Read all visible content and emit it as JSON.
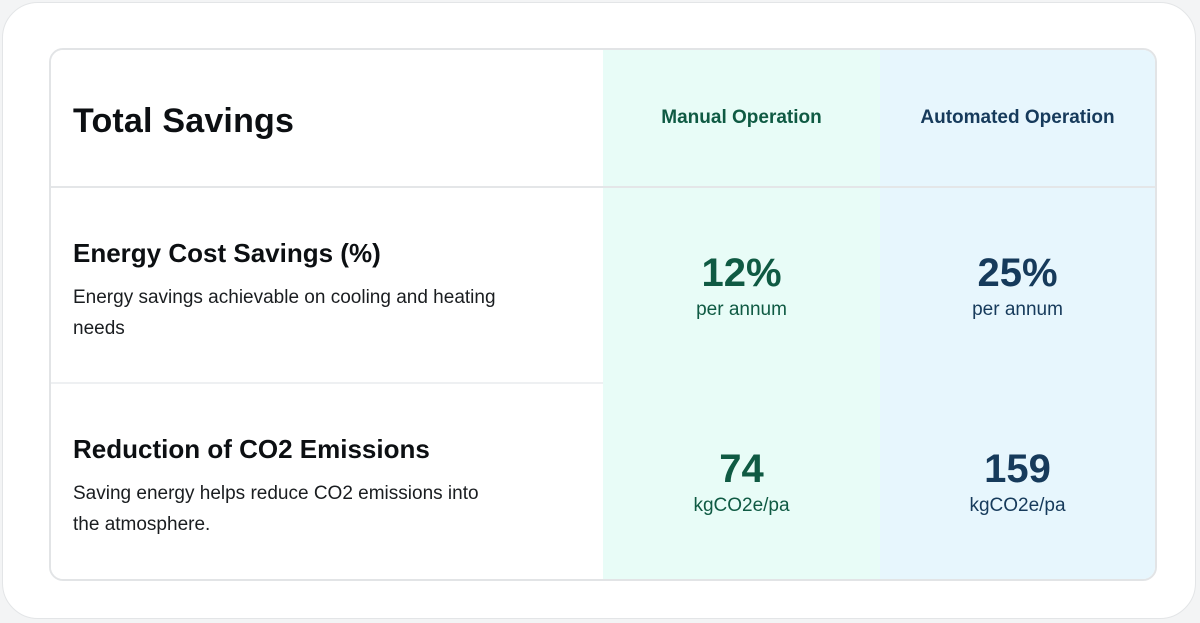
{
  "title": "Total Savings",
  "columns": {
    "manual": "Manual Operation",
    "automated": "Automated Operation"
  },
  "rows": [
    {
      "title": "Energy Cost Savings (%)",
      "description": "Energy savings achievable on cooling and heating needs",
      "manual_value": "12%",
      "manual_unit": "per annum",
      "automated_value": "25%",
      "automated_unit": "per annum"
    },
    {
      "title": "Reduction of CO2 Emissions",
      "description": "Saving energy helps reduce CO2 emissions into the atmosphere.",
      "manual_value": "74",
      "manual_unit": "kgCO2e/pa",
      "automated_value": "159",
      "automated_unit": "kgCO2e/pa"
    }
  ],
  "colors": {
    "manual_bg": "#e8fcf7",
    "automated_bg": "#e7f6fd",
    "manual_text": "#0f5a43",
    "automated_text": "#163a5b"
  }
}
